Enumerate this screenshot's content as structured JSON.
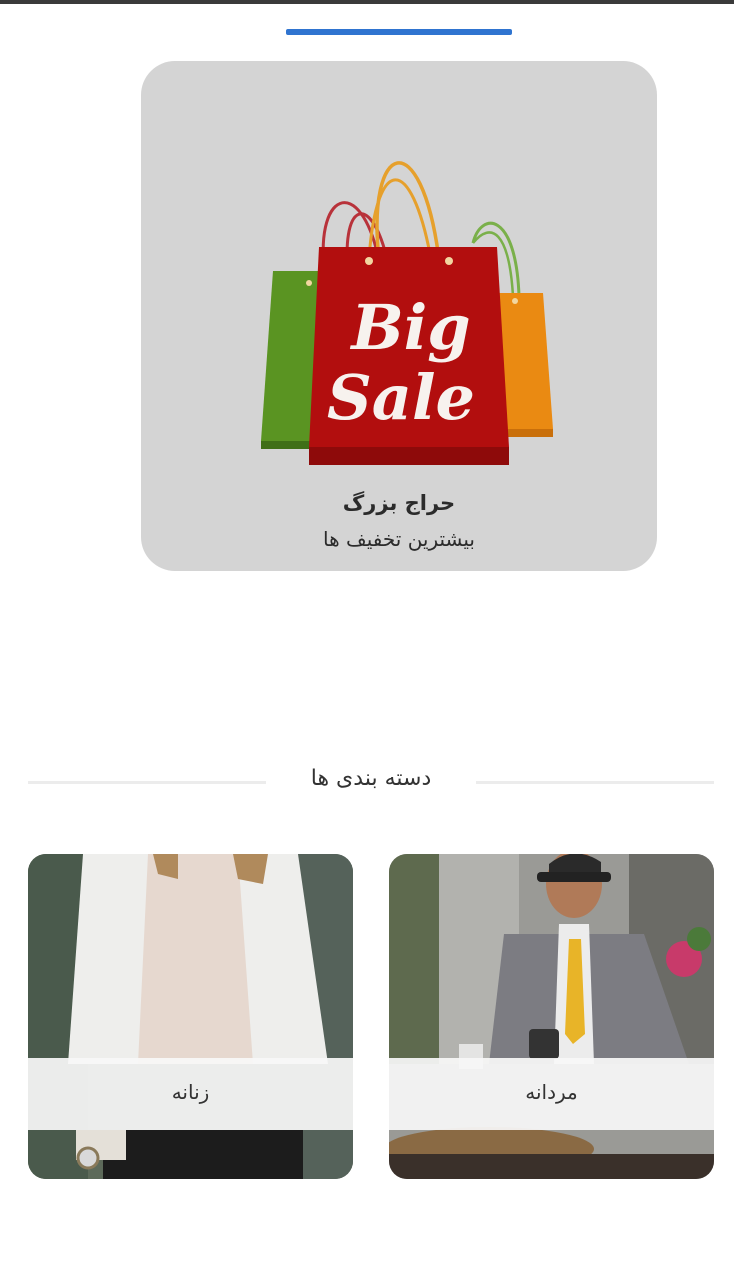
{
  "slider": {
    "active_indicator_color": "#2f74d0"
  },
  "promo": {
    "image_icon": "big-sale-shopping-bags",
    "image_text_line1": "Big",
    "image_text_line2": "Sale",
    "title": "حراج بزرگ",
    "subtitle": "بیشترین تخفیف ها",
    "background_color": "#d4d4d4"
  },
  "categories_section": {
    "title": "دسته بندی ها",
    "items": [
      {
        "label": "مردانه",
        "image": "men-fashion-photo"
      },
      {
        "label": "زنانه",
        "image": "women-fashion-photo"
      }
    ]
  }
}
